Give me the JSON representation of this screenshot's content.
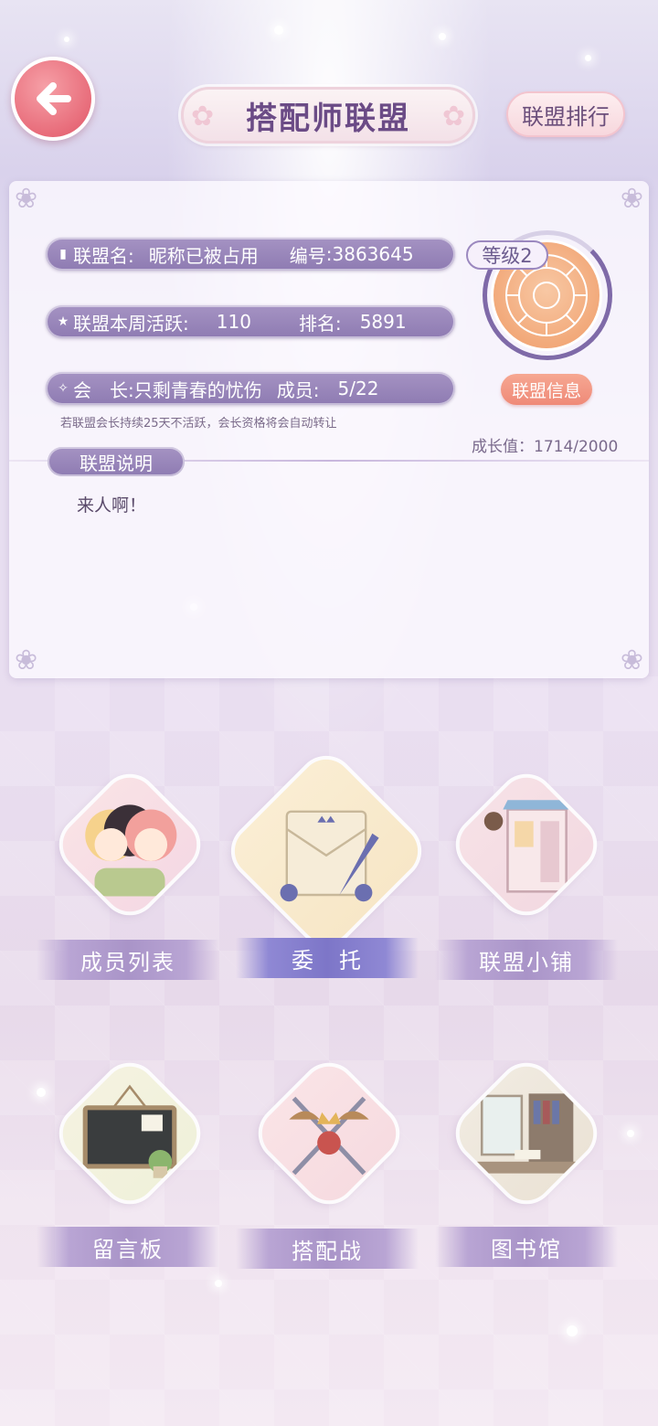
{
  "header": {
    "title": "搭配师联盟",
    "rank_button": "联盟排行"
  },
  "info": {
    "name_label": "联盟名:",
    "name_value": "昵称已被占用",
    "id_label": "编号",
    "id_value": ":3863645",
    "activity_label": "联盟本周活跃:",
    "activity_value": "110",
    "rank_label": "排名:",
    "rank_value": "5891",
    "leader_label": "会　长:",
    "leader_value": "只剩青春的忧伤",
    "members_label": "成员:",
    "members_value": "5/22",
    "notice": "若联盟会长持续25天不活跃，会长资格将会自动转让",
    "level": "等级2",
    "info_button": "联盟信息",
    "growth": "成长值：1714/2000",
    "desc_title": "联盟说明",
    "desc_text": "来人啊！"
  },
  "features": [
    {
      "label": "成员列表",
      "icon": "members-icon"
    },
    {
      "label": "委　托",
      "icon": "commission-icon"
    },
    {
      "label": "联盟小铺",
      "icon": "shop-icon"
    },
    {
      "label": "留言板",
      "icon": "message-board-icon"
    },
    {
      "label": "搭配战",
      "icon": "battle-icon"
    },
    {
      "label": "图书馆",
      "icon": "library-icon"
    }
  ],
  "colors": {
    "accent": "#8e7bb2",
    "back_button": "#e86c7a",
    "info_button": "#ef8a78"
  }
}
